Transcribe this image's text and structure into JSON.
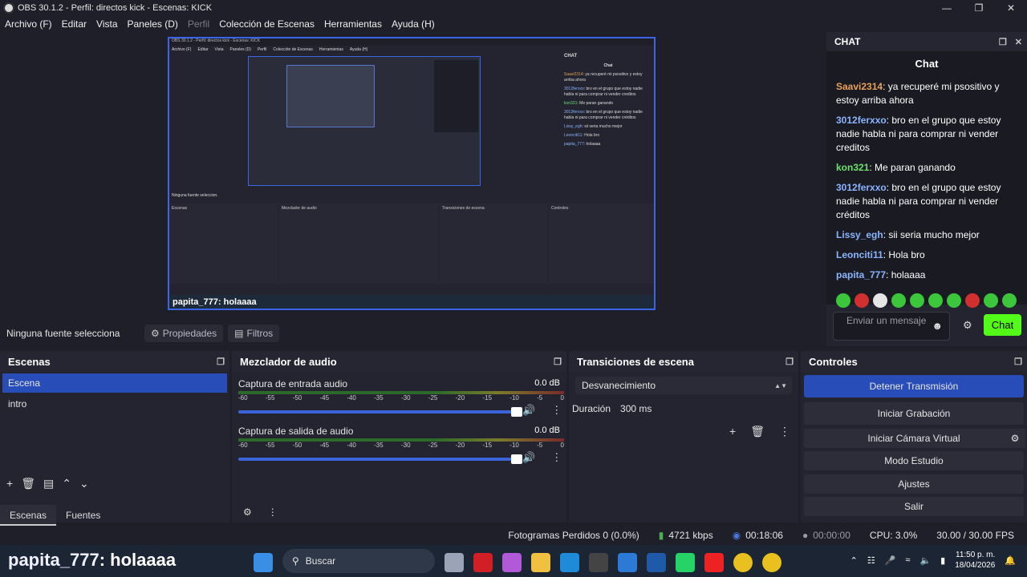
{
  "window": {
    "title": "OBS 30.1.2 - Perfil: directos kick - Escenas: KICK"
  },
  "menu": [
    "Archivo (F)",
    "Editar",
    "Vista",
    "Paneles (D)",
    "Perfil",
    "Colección de Escenas",
    "Herramientas",
    "Ayuda (H)"
  ],
  "preview": {
    "overlay_user": "papita_777",
    "overlay_msg": ": holaaaa",
    "mini_menu": [
      "Archivo (F)",
      "Editar",
      "Vista",
      "Paneles (D)",
      "Perfil",
      "Colección de Escenas",
      "Herramientas",
      "Ayuda (H)"
    ],
    "mini_status": "Ninguna fuente seleccion."
  },
  "source_bar": {
    "label": "Ninguna fuente selecciona",
    "props": "Propiedades",
    "filters": "Filtros"
  },
  "chat": {
    "dock_title": "CHAT",
    "subtitle": "Chat",
    "messages": [
      {
        "user": "Saavi2314",
        "text": ": ya recuperé mi psositivo y estoy arriba ahora",
        "color": "#e8a05a"
      },
      {
        "user": "3012ferxxo",
        "text": ": bro en el grupo que estoy nadie habla ni para comprar ni vender creditos",
        "color": "#8ab4ff"
      },
      {
        "user": "kon321",
        "text": ": Me paran ganando",
        "color": "#6ee06e"
      },
      {
        "user": "3012ferxxo",
        "text": ": bro en el grupo que estoy nadie habla ni para comprar ni vender créditos",
        "color": "#8ab4ff"
      },
      {
        "user": "Lissy_egh",
        "text": ": sii seria mucho mejor",
        "color": "#8ab4ff"
      },
      {
        "user": "Leonciti11",
        "text": ": Hola bro",
        "color": "#8ab4ff"
      },
      {
        "user": "papita_777",
        "text": ": holaaaa",
        "color": "#8ab4ff"
      }
    ],
    "input_placeholder": "Enviar un mensaje",
    "send_label": "Chat"
  },
  "scenes": {
    "title": "Escenas",
    "items": [
      "Escena",
      "intro"
    ],
    "tabs": [
      "Escenas",
      "Fuentes"
    ]
  },
  "mixer": {
    "title": "Mezclador de audio",
    "channels": [
      {
        "name": "Captura de entrada audio",
        "db": "0.0 dB"
      },
      {
        "name": "Captura de salida de audio",
        "db": "0.0 dB"
      }
    ],
    "ticks": [
      "-60",
      "-55",
      "-50",
      "-45",
      "-40",
      "-35",
      "-30",
      "-25",
      "-20",
      "-15",
      "-10",
      "-5",
      "0"
    ]
  },
  "transitions": {
    "title": "Transiciones de escena",
    "selected": "Desvanecimiento",
    "duration_label": "Duración",
    "duration_value": "300 ms"
  },
  "controls": {
    "title": "Controles",
    "buttons": [
      "Detener Transmisión",
      "Iniciar Grabación",
      "Iniciar Cámara Virtual",
      "Modo Estudio",
      "Ajustes",
      "Salir"
    ]
  },
  "status": {
    "dropped": "Fotogramas Perdidos 0 (0.0%)",
    "bitrate": "4721 kbps",
    "stream_time": "00:18:06",
    "rec_time": "00:00:00",
    "cpu": "CPU: 3.0%",
    "fps": "30.00 / 30.00 FPS"
  },
  "taskbar": {
    "overlay_user": "papita_777",
    "overlay_msg": ": holaaaa",
    "search": "Buscar",
    "time": "11:50 p. m.",
    "date": "18/04/2026"
  }
}
